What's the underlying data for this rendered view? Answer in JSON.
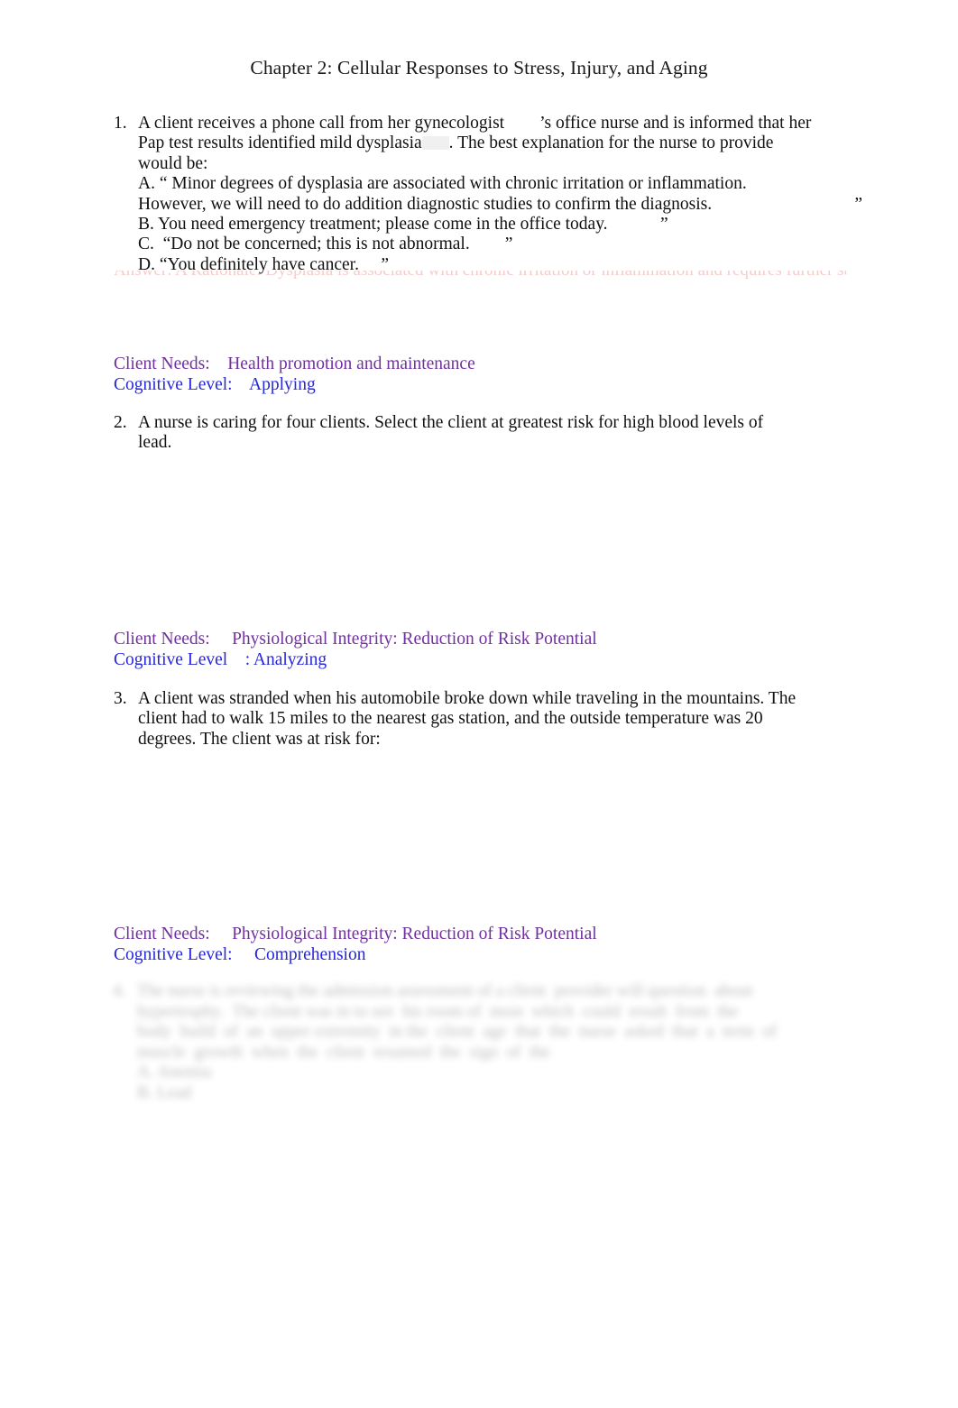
{
  "document": {
    "title": "Chapter 2: Cellular Responses to Stress, Injury, and Aging"
  },
  "questions": [
    {
      "number": "1.",
      "stem_lines": [
        "A client receives a phone call from her gynecologist        ’s office nurse and is informed that her",
        "Pap test results identified mild dysplasia",
        ". The best explanation for the nurse to provide",
        "would be:"
      ],
      "stem_line_1": "A client receives a phone call from her gynecologist        ’s office nurse and is informed that her",
      "stem_line_2a": "Pap test results identified mild dysplasia",
      "stem_line_2b": ". The best explanation for the nurse to provide",
      "stem_line_3": "would be:",
      "options": [
        "A. “ Minor degrees of dysplasia are associated with chronic irritation or inflammation.",
        "However, we will need to do addition diagnostic studies to confirm the diagnosis.",
        "B. You need emergency treatment; please come in the office today.            ”",
        "C.  “Do not be concerned; this is not abnormal.        ”",
        "D. “You definitely have cancer.     ”"
      ],
      "option_a_1": "A. “ Minor degrees of dysplasia are associated with chronic irritation or inflammation.",
      "option_a_2": "However, we will need to do addition diagnostic studies to confirm the diagnosis.",
      "option_a_2_quote": "”",
      "option_b": "B. You need emergency treatment; please come in the office today.            ”",
      "option_c": "C.  “Do not be concerned; this is not abnormal.        ”",
      "option_d": "D. “You definitely have cancer.     ”",
      "clipped_rationale": "Answer: A   Rationale: Dysplasia is associated with chronic irritation or inflammation and requires further study.",
      "client_needs_label": "Client Needs:",
      "client_needs_value": "Health promotion and maintenance",
      "cognitive_level_label": "Cognitive Level:",
      "cognitive_level_value": "Applying"
    },
    {
      "number": "2.",
      "stem_line_1": "A nurse is caring for four clients. Select the client at greatest risk for high blood levels of",
      "stem_line_2": "lead.",
      "client_needs_label": "Client Needs:",
      "client_needs_value": "Physiological Integrity: Reduction of Risk Potential",
      "cognitive_level_label": "Cognitive Level   ",
      "cognitive_level_value": ": Analyzing"
    },
    {
      "number": "3.",
      "stem_line_1": "A client was stranded when his automobile broke down while traveling in the mountains. The",
      "stem_line_2": "client had to walk 15 miles to the nearest gas station, and the outside temperature was 20",
      "stem_line_3": "degrees. The client was at risk for:",
      "client_needs_label": "Client Needs:",
      "client_needs_value": "Physiological Integrity: Reduction of Risk Potential",
      "cognitive_level_label": "Cognitive Level:",
      "cognitive_level_value": "Comprehension"
    }
  ],
  "redacted_question": {
    "number": "4.",
    "readable": false,
    "line_1": "The nurse is reviewing the admission assessment of a client  provider will question  about",
    "line_2": "hypertrophy.  The client was in to see  his room of  most  which  could  result  from  the",
    "line_3": "body  build  of  an  upper extremity  in the  client  age  that  the  nurse  asked  that  a  term  of",
    "line_4": "muscle  growth  when  the  client  resumed  the  sign  of  the",
    "option_a": "A. Anemia",
    "option_b": "B. Lead"
  },
  "colors": {
    "client_needs": "#70309f",
    "cognitive_level": "#2626dd",
    "body_text": "#111111",
    "clipped_rationale": "#e8908f",
    "page_background": "#ffffff"
  }
}
